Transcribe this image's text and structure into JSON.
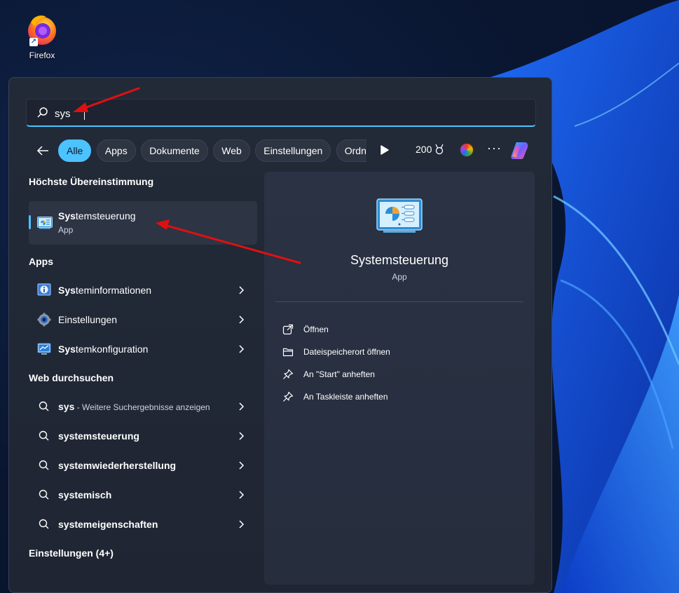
{
  "desktop": {
    "icons": [
      {
        "label": "Firefox",
        "icon": "firefox-icon"
      }
    ]
  },
  "search": {
    "value": "sys",
    "icon": "search-icon"
  },
  "filters": {
    "chips": [
      "Alle",
      "Apps",
      "Dokumente",
      "Web",
      "Einstellungen",
      "Ordner"
    ],
    "active": "Alle",
    "points": "200",
    "more_label": "···"
  },
  "best_match": {
    "heading": "Höchste Übereinstimmung",
    "name_bold": "Sys",
    "name_rest": "temsteuerung",
    "type": "App"
  },
  "apps": {
    "heading": "Apps",
    "items": [
      {
        "bold": "Sys",
        "rest": "teminformationen",
        "icon": "system-info-icon"
      },
      {
        "bold": "",
        "rest": "Einstellungen",
        "icon": "settings-gear-icon"
      },
      {
        "bold": "Sys",
        "rest": "temkonfiguration",
        "icon": "system-config-icon"
      }
    ]
  },
  "web": {
    "heading": "Web durchsuchen",
    "items": [
      {
        "bold": "sys",
        "suffix": " - Weitere Suchergebnisse anzeigen"
      },
      {
        "bold": "systemsteuerung",
        "suffix": ""
      },
      {
        "bold": "systemwiederherstellung",
        "suffix": ""
      },
      {
        "bold": "systemisch",
        "suffix": ""
      },
      {
        "bold": "systemeigenschaften",
        "suffix": ""
      }
    ]
  },
  "settings_section": {
    "heading": "Einstellungen (4+)"
  },
  "detail": {
    "name": "Systemsteuerung",
    "type": "App",
    "actions": [
      {
        "label": "Öffnen",
        "icon": "open-external-icon"
      },
      {
        "label": "Dateispeicherort öffnen",
        "icon": "folder-icon"
      },
      {
        "label": "An \"Start\" anheften",
        "icon": "pin-icon"
      },
      {
        "label": "An Taskleiste anheften",
        "icon": "pin-icon"
      }
    ]
  },
  "colors": {
    "accent": "#4cc2ff",
    "annotation_arrow": "#e01010",
    "panel": "#222a38"
  }
}
